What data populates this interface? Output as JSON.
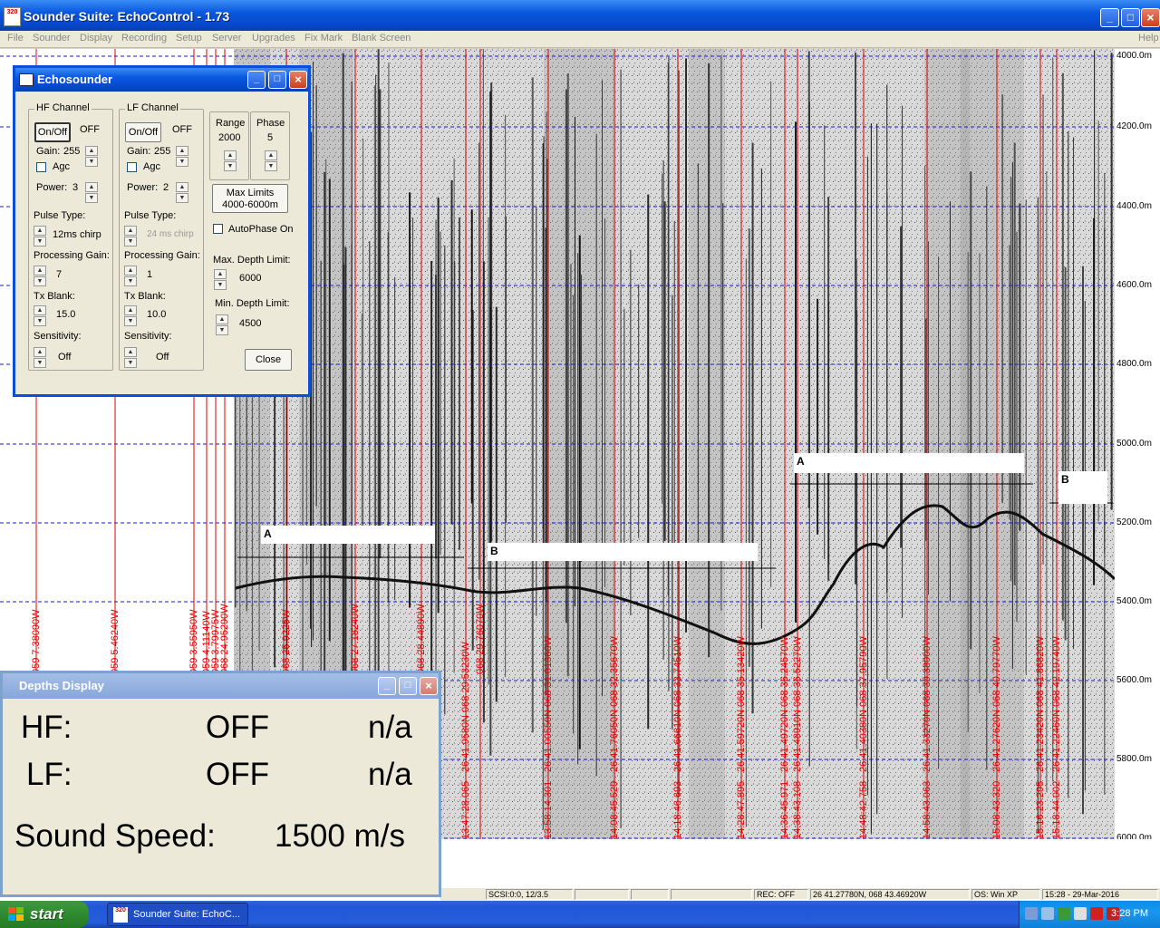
{
  "window": {
    "title": "Sounder Suite: EchoControl - 1.73",
    "icon_text": "320"
  },
  "menu": [
    "File",
    "Sounder",
    "Display",
    "Recording",
    "Setup",
    "Server",
    "Upgrades",
    "Fix Mark",
    "Blank Screen"
  ],
  "menu_help": "Help",
  "depth_ticks": [
    "4000.0m",
    "4200.0m",
    "4400.0m",
    "4600.0m",
    "4800.0m",
    "5000.0m",
    "5200.0m",
    "5400.0m",
    "5600.0m",
    "5800.0m",
    "6000.0m"
  ],
  "markers": {
    "a1": "A",
    "b1": "B",
    "a2": "A",
    "b2": "B"
  },
  "fix_marks": [
    "059 7.38090W",
    "059 5.46240W",
    "059 3.55950W",
    "059 4.11140W",
    "059 3.79975W",
    "068 24.95290W",
    "068 25.9225W",
    "068 27.18240W",
    "068 28.44890W",
    "13:47:28.065 - 26 41.9580N 068 29.53230W",
    "068 29.76070W",
    "13:58:14.301 - 26 41.00550N 068 31.01360W",
    "14:08:45.529 - 26 41.76050N 068 32.35670W",
    "14:18:46.693 - 26 41.66610N 068 33.74510W",
    "14:28:47.895 - 26 41.59720N 068 35.13420W",
    "14:36:45.971 - 26 41.49720N 068 36.24570W",
    "14:38:43.108 - 26 41.48910N 068 36.52270W",
    "14:48:42.758 - 26 41.40380N 068 37.95790W",
    "14:58:43.063 - 26 41.33270N 068 39.38900W",
    "15:08:43.320 - 26 41.27620N 068 40.79770W",
    "15:16:23.295 - 26 41.23420N 068 41.86820W",
    "15:18:44.002 - 26 41.22460N 068 42.19740W"
  ],
  "status": {
    "scsi": "SCSI:0:0, 12/3.5",
    "rec": "REC: OFF",
    "position": "26 41.27780N, 068 43.46920W",
    "os": "OS: Win XP",
    "datetime": "15:28 - 29-Mar-2016"
  },
  "echosounder": {
    "title": "Echosounder",
    "hf": {
      "group": "HF Channel",
      "onoff_btn": "On/Off",
      "state": "OFF",
      "gain_label": "Gain:",
      "gain": "255",
      "agc": "Agc",
      "power_label": "Power:",
      "power": "3",
      "pulse_label": "Pulse Type:",
      "pulse": "12ms chirp",
      "proc_label": "Processing Gain:",
      "proc": "7",
      "tx_label": "Tx Blank:",
      "tx": "15.0",
      "sens_label": "Sensitivity:",
      "sens": "Off"
    },
    "lf": {
      "group": "LF Channel",
      "onoff_btn": "On/Off",
      "state": "OFF",
      "gain_label": "Gain:",
      "gain": "255",
      "agc": "Agc",
      "power_label": "Power:",
      "power": "2",
      "pulse_label": "Pulse Type:",
      "pulse": "24 ms chirp",
      "proc_label": "Processing Gain:",
      "proc": "1",
      "tx_label": "Tx Blank:",
      "tx": "10.0",
      "sens_label": "Sensitivity:",
      "sens": "Off"
    },
    "range_label": "Range",
    "range": "2000",
    "phase_label": "Phase",
    "phase": "5",
    "maxlimits_line1": "Max Limits",
    "maxlimits_line2": "4000-6000m",
    "autophase": "AutoPhase On",
    "maxdepth_label": "Max. Depth Limit:",
    "maxdepth": "6000",
    "mindepth_label": "Min. Depth Limit:",
    "mindepth": "4500",
    "close": "Close"
  },
  "depths_display": {
    "title": "Depths Display",
    "hf_label": "HF:",
    "hf_state": "OFF",
    "hf_value": "n/a",
    "lf_label": "LF:",
    "lf_state": "OFF",
    "lf_value": "n/a",
    "speed_label": "Sound Speed:",
    "speed_value": "1500 m/s"
  },
  "taskbar": {
    "start": "start",
    "task": "Sounder Suite: EchoC...",
    "clock": "3:28 PM"
  },
  "colors": {
    "xp_blue": "#0a58e0",
    "fix_line": "#e00000",
    "grid": "#1a1acc"
  }
}
